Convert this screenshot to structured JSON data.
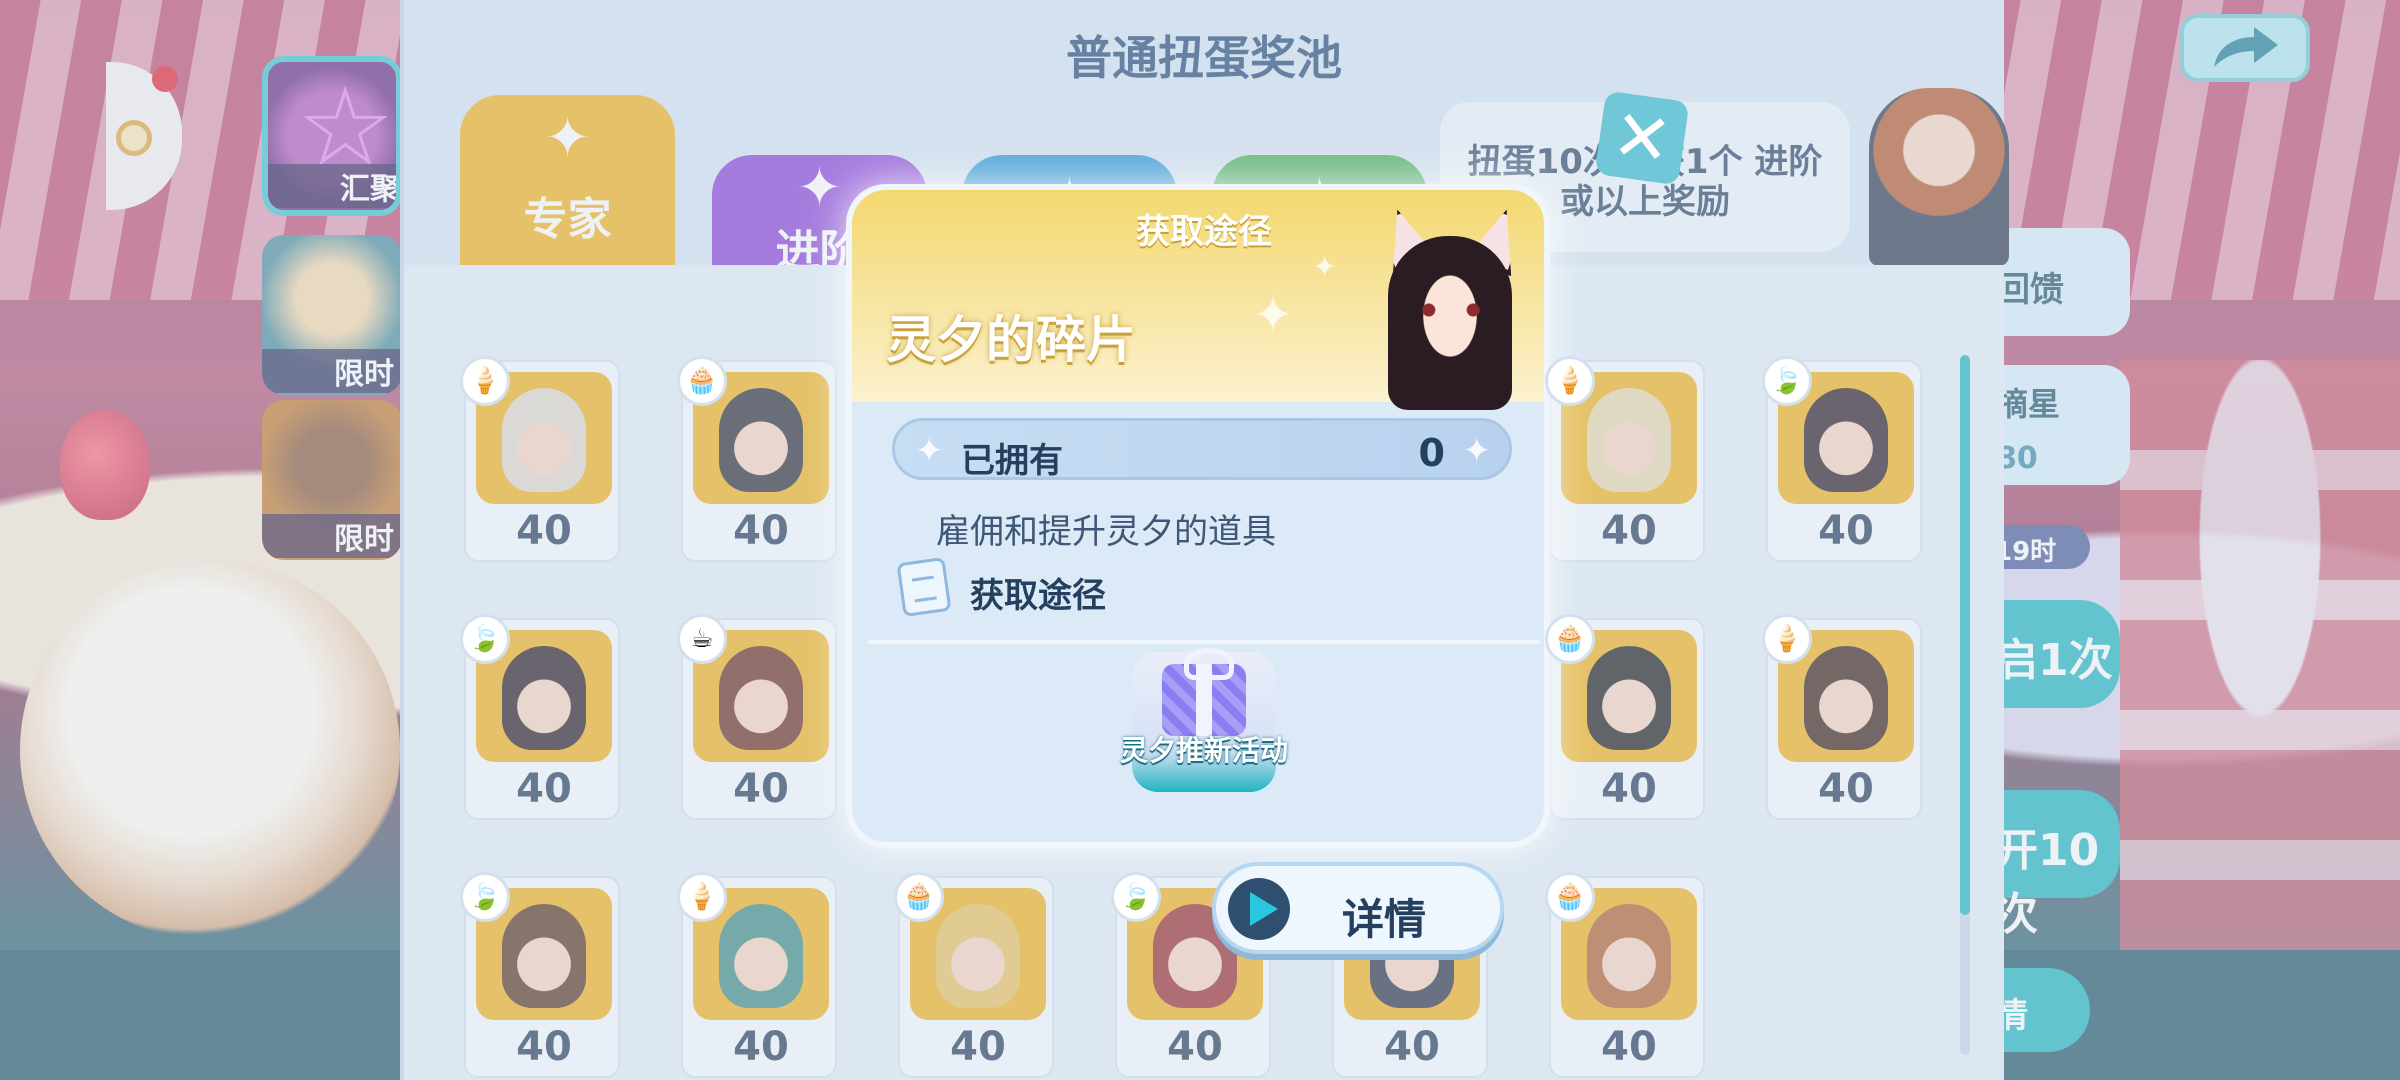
{
  "pool": {
    "title": "普通扭蛋奖池",
    "tabs": [
      {
        "label": "专家",
        "color": "#f1b21b"
      },
      {
        "label": "进阶",
        "color": "#8a42d7"
      },
      {
        "label": "",
        "color": "#1b8fd0"
      },
      {
        "label": "",
        "color": "#3aa84a"
      }
    ],
    "guarantee_text": "扭蛋10次必获1个 进阶或以上奖励",
    "cards": [
      {
        "count": "40",
        "category_icon": "ice-cream-icon",
        "hair": "#e0d7c9"
      },
      {
        "count": "40",
        "category_icon": "cupcake-icon",
        "hair": "#2b2a33"
      },
      {
        "count": "40",
        "category_icon": "ice-cream-icon",
        "hair": "#e8d7a8"
      },
      {
        "count": "40",
        "category_icon": "leaf-icon",
        "hair": "#2b1b22"
      },
      {
        "count": "40",
        "category_icon": "leaf-icon",
        "hair": "#2b1b22"
      },
      {
        "count": "40",
        "category_icon": "coffee-bean-icon",
        "hair": "#6a2e1e"
      },
      {
        "count": "40",
        "category_icon": "cupcake-icon",
        "hair": "#1c1c1c"
      },
      {
        "count": "40",
        "category_icon": "ice-cream-icon",
        "hair": "#3a2118"
      },
      {
        "count": "40",
        "category_icon": "leaf-icon",
        "hair": "#5a3420"
      },
      {
        "count": "40",
        "category_icon": "ice-cream-icon",
        "hair": "#3c8a84"
      },
      {
        "count": "40",
        "category_icon": "cupcake-icon",
        "hair": "#e9c25e"
      },
      {
        "count": "40",
        "category_icon": "leaf-icon",
        "hair": "#9a2a2a"
      },
      {
        "count": "40",
        "category_icon": "",
        "hair": "#2b2f45"
      },
      {
        "count": "40",
        "category_icon": "cupcake-icon",
        "hair": "#b0612e"
      }
    ]
  },
  "side": {
    "tabs": [
      {
        "label": "汇聚"
      },
      {
        "label": "限时"
      },
      {
        "label": "限时"
      }
    ]
  },
  "right_panel": {
    "feedback": "回馈",
    "star_label": "摘星",
    "star_value": "80",
    "timer": "19时",
    "draw_once": "启1次",
    "draw_ten": "开10次",
    "detail": "情"
  },
  "popup": {
    "title": "获取途径",
    "item_name": "灵夕的碎片",
    "owned_label": "已拥有",
    "owned_value": "0",
    "description": "雇佣和提升灵夕的道具",
    "source_label": "获取途径",
    "activity_label": "灵夕推新活动"
  },
  "detail_button": {
    "label": "详情"
  },
  "colors": {
    "accent": "#1fb4bf",
    "gold": "#f1b21b",
    "navy_text": "#25405e"
  }
}
